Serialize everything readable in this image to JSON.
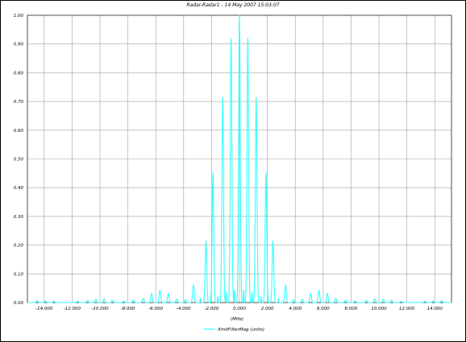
{
  "chart_data": {
    "type": "line",
    "title": "Radar-Radar1 - 14 May 2007 15:03:07",
    "xlabel": "(MHz)",
    "ylabel": "",
    "xlim": [
      -15.2,
      15.2
    ],
    "ylim": [
      0,
      1.0
    ],
    "grid": true,
    "legend_position": "bottom-center",
    "line_color": "#33ffff",
    "x_ticks": [
      "-14.000",
      "-12.000",
      "-10.000",
      "-8.000",
      "-6.000",
      "-4.000",
      "-2.000",
      "0.000",
      "2.000",
      "4.000",
      "6.000",
      "8.000",
      "10.000",
      "12.000",
      "14.000"
    ],
    "y_ticks": [
      "0.00",
      "0.10",
      "0.20",
      "0.30",
      "0.40",
      "0.50",
      "0.60",
      "0.70",
      "0.80",
      "0.90",
      "1.00"
    ],
    "series": [
      {
        "name": "XmitFilterMag (units)",
        "peaks": [
          {
            "x": -14.5,
            "y": 0.008
          },
          {
            "x": -13.9,
            "y": 0.006
          },
          {
            "x": -13.3,
            "y": 0.005
          },
          {
            "x": -11.6,
            "y": 0.005
          },
          {
            "x": -10.9,
            "y": 0.008
          },
          {
            "x": -10.3,
            "y": 0.012
          },
          {
            "x": -9.7,
            "y": 0.014
          },
          {
            "x": -9.1,
            "y": 0.008
          },
          {
            "x": -8.3,
            "y": 0.006
          },
          {
            "x": -7.6,
            "y": 0.008
          },
          {
            "x": -6.9,
            "y": 0.015
          },
          {
            "x": -6.3,
            "y": 0.032
          },
          {
            "x": -5.7,
            "y": 0.043
          },
          {
            "x": -5.1,
            "y": 0.032
          },
          {
            "x": -4.5,
            "y": 0.012
          },
          {
            "x": -3.9,
            "y": 0.01
          },
          {
            "x": -3.3,
            "y": 0.062
          },
          {
            "x": -2.4,
            "y": 0.215
          },
          {
            "x": -1.9,
            "y": 0.452
          },
          {
            "x": -1.2,
            "y": 0.715
          },
          {
            "x": -0.6,
            "y": 0.92
          },
          {
            "x": 0.0,
            "y": 1.0
          },
          {
            "x": 0.6,
            "y": 0.92
          },
          {
            "x": 1.2,
            "y": 0.715
          },
          {
            "x": 1.9,
            "y": 0.452
          },
          {
            "x": 2.4,
            "y": 0.215
          },
          {
            "x": 3.3,
            "y": 0.062
          },
          {
            "x": 3.9,
            "y": 0.01
          },
          {
            "x": 4.5,
            "y": 0.012
          },
          {
            "x": 5.1,
            "y": 0.032
          },
          {
            "x": 5.7,
            "y": 0.043
          },
          {
            "x": 6.3,
            "y": 0.032
          },
          {
            "x": 6.9,
            "y": 0.015
          },
          {
            "x": 7.6,
            "y": 0.008
          },
          {
            "x": 8.3,
            "y": 0.006
          },
          {
            "x": 9.1,
            "y": 0.008
          },
          {
            "x": 9.7,
            "y": 0.014
          },
          {
            "x": 10.3,
            "y": 0.012
          },
          {
            "x": 10.9,
            "y": 0.008
          },
          {
            "x": 11.6,
            "y": 0.005
          },
          {
            "x": 13.3,
            "y": 0.005
          },
          {
            "x": 13.9,
            "y": 0.006
          },
          {
            "x": 14.5,
            "y": 0.008
          }
        ],
        "minor_peaks": [
          {
            "x": -1.55,
            "y": 0.02
          },
          {
            "x": -0.95,
            "y": 0.035
          },
          {
            "x": -0.35,
            "y": 0.045
          },
          {
            "x": 0.3,
            "y": 0.045
          },
          {
            "x": 0.9,
            "y": 0.035
          },
          {
            "x": 1.55,
            "y": 0.02
          },
          {
            "x": -2.8,
            "y": 0.015
          },
          {
            "x": 2.8,
            "y": 0.015
          }
        ]
      }
    ]
  }
}
